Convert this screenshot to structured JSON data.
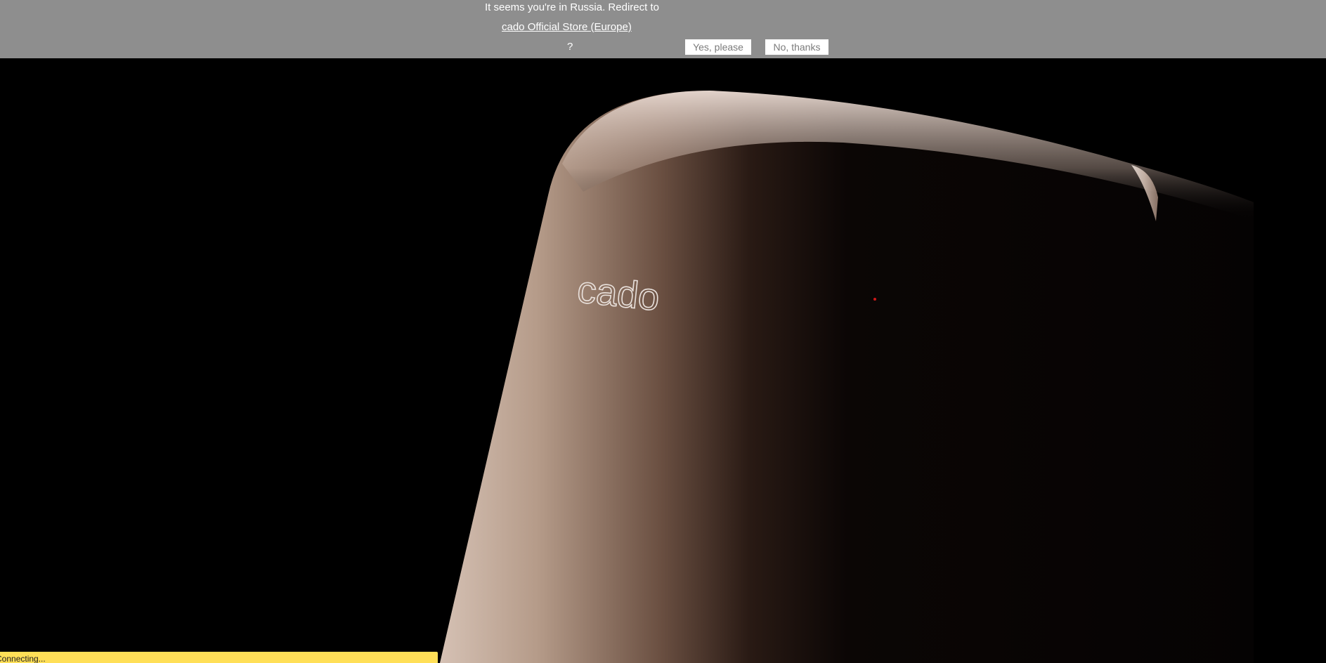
{
  "geo_banner": {
    "message": "It seems you're in Russia. Redirect to",
    "store_link": "cado Official Store (Europe)",
    "question_mark": "?",
    "yes_label": "Yes, please",
    "no_label": "No, thanks"
  },
  "hero": {
    "product_logo_text": "cado"
  },
  "status": {
    "text": "Connecting..."
  }
}
